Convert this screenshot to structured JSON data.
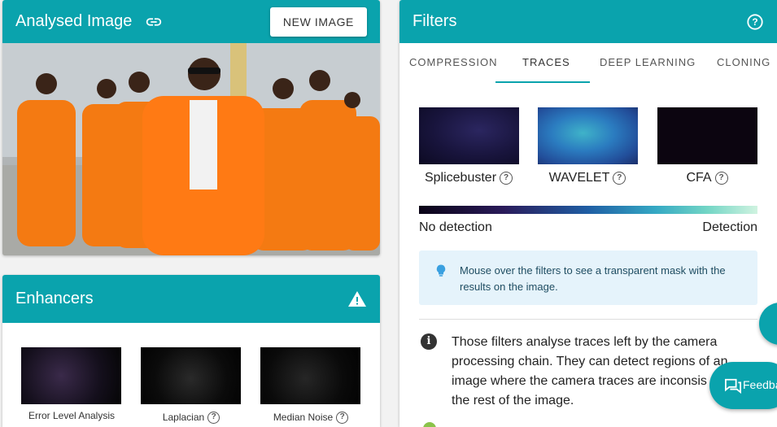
{
  "analysed": {
    "title": "Analysed Image",
    "new_image_label": "NEW IMAGE"
  },
  "enhancers": {
    "title": "Enhancers",
    "items": [
      {
        "label": "Error Level Analysis"
      },
      {
        "label": "Laplacian"
      },
      {
        "label": "Median Noise"
      }
    ]
  },
  "filters": {
    "title": "Filters",
    "tabs": [
      {
        "label": "COMPRESSION"
      },
      {
        "label": "TRACES"
      },
      {
        "label": "DEEP LEARNING"
      },
      {
        "label": "CLONING"
      }
    ],
    "active_tab": "TRACES",
    "results": [
      {
        "label": "Splicebuster"
      },
      {
        "label": "WAVELET"
      },
      {
        "label": "CFA"
      }
    ],
    "scale": {
      "low_label": "No detection",
      "high_label": "Detection"
    },
    "hint": "Mouse over the filters to see a transparent mask with the results on the image.",
    "description": "Those filters analyse traces left by the camera processing chain. They can detect regions of an image where the camera traces are inconsis with the rest of the image."
  },
  "feedback": {
    "label": "Feedba"
  },
  "colors": {
    "accent": "#0aa3ad",
    "info_bg": "#e5f3fb",
    "prison_orange": "#f47a12"
  }
}
